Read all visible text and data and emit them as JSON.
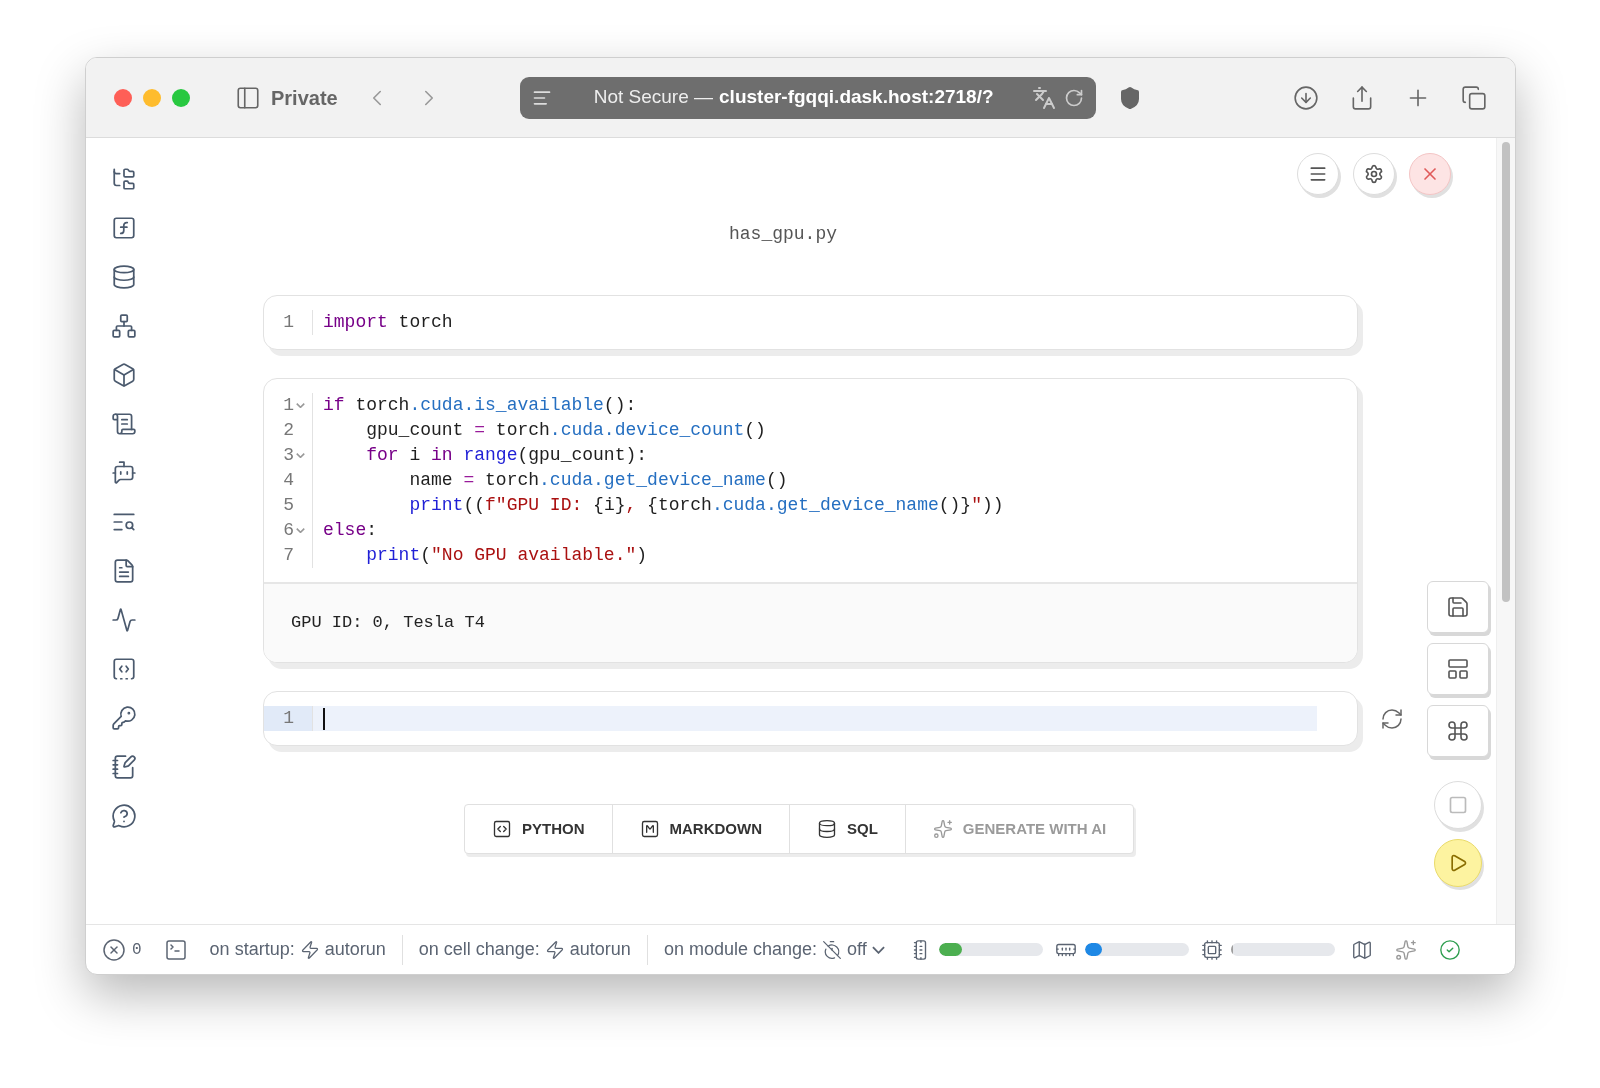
{
  "browser": {
    "private_label": "Private",
    "security": "Not Secure —",
    "address": "cluster-fgqqi.dask.host:2718/?"
  },
  "notebook": {
    "filename": "has_gpu.py",
    "cells": [
      {
        "focused": false,
        "lines": [
          {
            "number": "1",
            "foldable": false,
            "active": false,
            "tokens": [
              {
                "kind": "kw",
                "t": "import"
              },
              {
                "kind": "plain",
                "t": " torch"
              }
            ]
          }
        ]
      },
      {
        "focused": false,
        "lines": [
          {
            "number": "1",
            "foldable": true,
            "active": false,
            "tokens": [
              {
                "kind": "kw",
                "t": "if"
              },
              {
                "kind": "plain",
                "t": " torch"
              },
              {
                "kind": "attr",
                "t": ".cuda.is_available"
              },
              {
                "kind": "plain",
                "t": "():"
              }
            ]
          },
          {
            "number": "2",
            "foldable": false,
            "active": false,
            "tokens": [
              {
                "kind": "plain",
                "t": "    gpu_count "
              },
              {
                "kind": "op",
                "t": "="
              },
              {
                "kind": "plain",
                "t": " torch"
              },
              {
                "kind": "attr",
                "t": ".cuda.device_count"
              },
              {
                "kind": "plain",
                "t": "()"
              }
            ]
          },
          {
            "number": "3",
            "foldable": true,
            "active": false,
            "tokens": [
              {
                "kind": "kw",
                "t": "    for"
              },
              {
                "kind": "plain",
                "t": " i "
              },
              {
                "kind": "kw",
                "t": "in"
              },
              {
                "kind": "builtin",
                "t": " range"
              },
              {
                "kind": "plain",
                "t": "(gpu_count):"
              }
            ]
          },
          {
            "number": "4",
            "foldable": false,
            "active": false,
            "tokens": [
              {
                "kind": "plain",
                "t": "        name "
              },
              {
                "kind": "op",
                "t": "="
              },
              {
                "kind": "plain",
                "t": " torch"
              },
              {
                "kind": "attr",
                "t": ".cuda.get_device_name"
              },
              {
                "kind": "plain",
                "t": "()"
              }
            ]
          },
          {
            "number": "5",
            "foldable": false,
            "active": false,
            "tokens": [
              {
                "kind": "builtin",
                "t": "        print"
              },
              {
                "kind": "plain",
                "t": "(("
              },
              {
                "kind": "str",
                "t": "f\"GPU ID: "
              },
              {
                "kind": "plain",
                "t": "{i}"
              },
              {
                "kind": "str",
                "t": ", "
              },
              {
                "kind": "plain",
                "t": "{torch"
              },
              {
                "kind": "attr",
                "t": ".cuda.get_device_name"
              },
              {
                "kind": "plain",
                "t": "()}"
              },
              {
                "kind": "str",
                "t": "\""
              },
              {
                "kind": "plain",
                "t": "))"
              }
            ]
          },
          {
            "number": "6",
            "foldable": true,
            "active": false,
            "tokens": [
              {
                "kind": "kw",
                "t": "else"
              },
              {
                "kind": "plain",
                "t": ":"
              }
            ]
          },
          {
            "number": "7",
            "foldable": false,
            "active": false,
            "tokens": [
              {
                "kind": "builtin",
                "t": "    print"
              },
              {
                "kind": "plain",
                "t": "("
              },
              {
                "kind": "str",
                "t": "\"No GPU available.\""
              },
              {
                "kind": "plain",
                "t": ")"
              }
            ]
          }
        ],
        "output": "GPU ID: 0, Tesla T4"
      },
      {
        "focused": true,
        "lines": [
          {
            "number": "1",
            "foldable": false,
            "active": true
          }
        ]
      }
    ]
  },
  "cell_types": [
    {
      "kind": "python",
      "label": "PYTHON",
      "disabled": false
    },
    {
      "kind": "markdown",
      "label": "MARKDOWN",
      "disabled": false
    },
    {
      "kind": "sql",
      "label": "SQL",
      "disabled": false
    },
    {
      "kind": "ai",
      "label": "GENERATE WITH AI",
      "disabled": true
    }
  ],
  "status_bar": {
    "errors": "0",
    "reactivity": [
      {
        "kind": "startup",
        "label": "on startup:",
        "value": "autorun"
      },
      {
        "kind": "cell_change",
        "label": "on cell change:",
        "value": "autorun"
      },
      {
        "kind": "module_change",
        "label": "on module change:",
        "value": "off"
      }
    ],
    "meters": [
      {
        "kind": "memory",
        "level": 0.22,
        "color": "#4caf50"
      },
      {
        "kind": "gpu",
        "level": 0.17,
        "color": "#1e88e5"
      },
      {
        "kind": "cpu",
        "level": 0.02,
        "color": "#9e9e9e"
      }
    ],
    "healthy": true
  }
}
